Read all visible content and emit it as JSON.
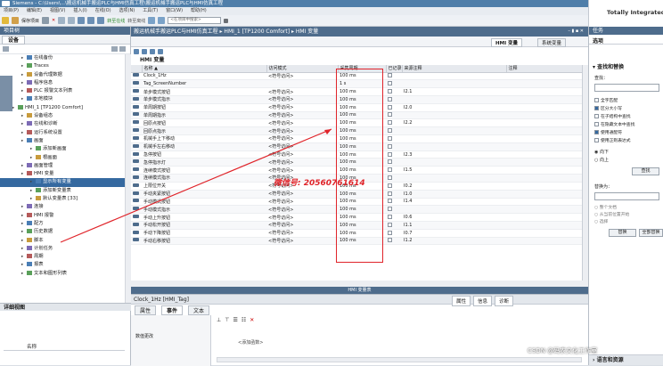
{
  "window_title": "Siemens - C:\\Users\\...\\搬运机械手搬运PLC与HMI仿真工程\\搬运机械手搬运PLC与HMI仿真工程",
  "app_name": "Totally Integrated",
  "menu": [
    "项目(P)",
    "编辑(E)",
    "视图(V)",
    "插入(I)",
    "在线(O)",
    "选项(N)",
    "工具(T)",
    "窗口(W)",
    "帮助(H)"
  ],
  "toolbar": {
    "save_label": "保存项目",
    "online_label": "转至在线",
    "offline_label": "转至离线",
    "search_placeholder": "<在项目中搜索>"
  },
  "left_panel": {
    "title": "项目树",
    "tab": "设备",
    "tree": [
      {
        "label": "在线备份",
        "indent": 2
      },
      {
        "label": "Traces",
        "indent": 2
      },
      {
        "label": "设备代理数据",
        "indent": 2
      },
      {
        "label": "程序信息",
        "indent": 2
      },
      {
        "label": "PLC 报警文本列表",
        "indent": 2
      },
      {
        "label": "本地模块",
        "indent": 2
      },
      {
        "label": "HMI_1 [TP1200 Comfort]",
        "indent": 1
      },
      {
        "label": "设备组态",
        "indent": 2
      },
      {
        "label": "在线和诊断",
        "indent": 2
      },
      {
        "label": "运行系统设置",
        "indent": 2
      },
      {
        "label": "画面",
        "indent": 2
      },
      {
        "label": "添加新画面",
        "indent": 3
      },
      {
        "label": "根画面",
        "indent": 3
      },
      {
        "label": "画面管理",
        "indent": 2
      },
      {
        "label": "HMI 变量",
        "indent": 2
      },
      {
        "label": "显示所有变量",
        "indent": 3,
        "selected": true
      },
      {
        "label": "添加新变量表",
        "indent": 3
      },
      {
        "label": "默认变量表 [33]",
        "indent": 3
      },
      {
        "label": "连接",
        "indent": 2
      },
      {
        "label": "HMI 报警",
        "indent": 2
      },
      {
        "label": "配方",
        "indent": 2
      },
      {
        "label": "历史数据",
        "indent": 2
      },
      {
        "label": "脚本",
        "indent": 2
      },
      {
        "label": "计划任务",
        "indent": 2
      },
      {
        "label": "周期",
        "indent": 2
      },
      {
        "label": "报表",
        "indent": 2
      },
      {
        "label": "文本和图形列表",
        "indent": 2
      }
    ]
  },
  "detail_view": {
    "title": "详细视图",
    "col_name": "名称"
  },
  "main": {
    "breadcrumb": "搬运机械手搬运PLC与HMI仿真工程 ▸ HMI_1 [TP1200 Comfort] ▸ HMI 变量",
    "tab_hmi_vars": "HMI 变量",
    "tab_sys_vars": "系统变量",
    "grid_title": "HMI 变量",
    "columns": [
      "名称 ▲",
      "访问模式",
      "采集周期",
      "已记录",
      "来源注释",
      "注释"
    ],
    "rows": [
      {
        "name": "Clock_1Hz",
        "access": "<符号访问>",
        "cycle": "100 ms",
        "comment": ""
      },
      {
        "name": "Tag_ScreenNumber",
        "access": "",
        "cycle": "1 s",
        "comment": ""
      },
      {
        "name": "单步模式按钮",
        "access": "<符号访问>",
        "cycle": "100 ms",
        "comment": "I2.1"
      },
      {
        "name": "单步模式指示",
        "access": "<符号访问>",
        "cycle": "100 ms",
        "comment": ""
      },
      {
        "name": "单周期按钮",
        "access": "<符号访问>",
        "cycle": "100 ms",
        "comment": "I2.0"
      },
      {
        "name": "单周期指示",
        "access": "<符号访问>",
        "cycle": "100 ms",
        "comment": ""
      },
      {
        "name": "回原点按钮",
        "access": "<符号访问>",
        "cycle": "100 ms",
        "comment": "I2.2"
      },
      {
        "name": "回原点指示",
        "access": "<符号访问>",
        "cycle": "100 ms",
        "comment": ""
      },
      {
        "name": "机械手上下移动",
        "access": "<符号访问>",
        "cycle": "100 ms",
        "comment": ""
      },
      {
        "name": "机械手左右移动",
        "access": "<符号访问>",
        "cycle": "100 ms",
        "comment": ""
      },
      {
        "name": "急停按钮",
        "access": "<符号访问>",
        "cycle": "100 ms",
        "comment": "I2.3"
      },
      {
        "name": "急停指示灯",
        "access": "<符号访问>",
        "cycle": "100 ms",
        "comment": ""
      },
      {
        "name": "连续模式按钮",
        "access": "<符号访问>",
        "cycle": "100 ms",
        "comment": "I1.5"
      },
      {
        "name": "连续模式指示",
        "access": "<符号访问>",
        "cycle": "100 ms",
        "comment": ""
      },
      {
        "name": "上限位开关",
        "access": "<符号访问>",
        "cycle": "100 ms",
        "comment": "I0.2"
      },
      {
        "name": "手动夹紧按钮",
        "access": "<符号访问>",
        "cycle": "100 ms",
        "comment": "I1.0"
      },
      {
        "name": "手动模式按钮",
        "access": "<符号访问>",
        "cycle": "100 ms",
        "comment": "I1.4"
      },
      {
        "name": "手动模式指示",
        "access": "<符号访问>",
        "cycle": "100 ms",
        "comment": ""
      },
      {
        "name": "手动上升按钮",
        "access": "<符号访问>",
        "cycle": "100 ms",
        "comment": "I0.6"
      },
      {
        "name": "手动松开按钮",
        "access": "<符号访问>",
        "cycle": "100 ms",
        "comment": "I1.1"
      },
      {
        "name": "手动下降按钮",
        "access": "<符号访问>",
        "cycle": "100 ms",
        "comment": "I0.7"
      },
      {
        "name": "手动右移按钮",
        "access": "<符号访问>",
        "cycle": "100 ms",
        "comment": "I1.2"
      }
    ],
    "hscroll_label": "HMI 变量表"
  },
  "watermark": "微信号: 20560761614",
  "inspector": {
    "title": "Clock_1Hz [HMI_Tag]",
    "tabs": [
      "属性",
      "事件",
      "文本"
    ],
    "right_tabs": [
      "属性",
      "信息",
      "诊断"
    ],
    "event_item": "数值更改",
    "add_function": "<添加函数>"
  },
  "right_panel": {
    "header": "任务",
    "options_label": "选项",
    "section": "查找和替换",
    "find_label": "查找：",
    "checks": [
      "全字匹配",
      "区分大小写",
      "在子结构中查找",
      "在隐藏文本中查找",
      "使用通配符",
      "使用正则表达式"
    ],
    "radios": [
      "向下",
      "向上"
    ],
    "find_button": "查找",
    "replace_label": "替换为：",
    "replace_opts": [
      "整个文档",
      "从当前位置开始",
      "选择"
    ],
    "replace_button": "替换",
    "replace_all_button": "全部替换",
    "bottom_section": "语言和资源"
  },
  "footer": "CSDN @码农文化工作室"
}
